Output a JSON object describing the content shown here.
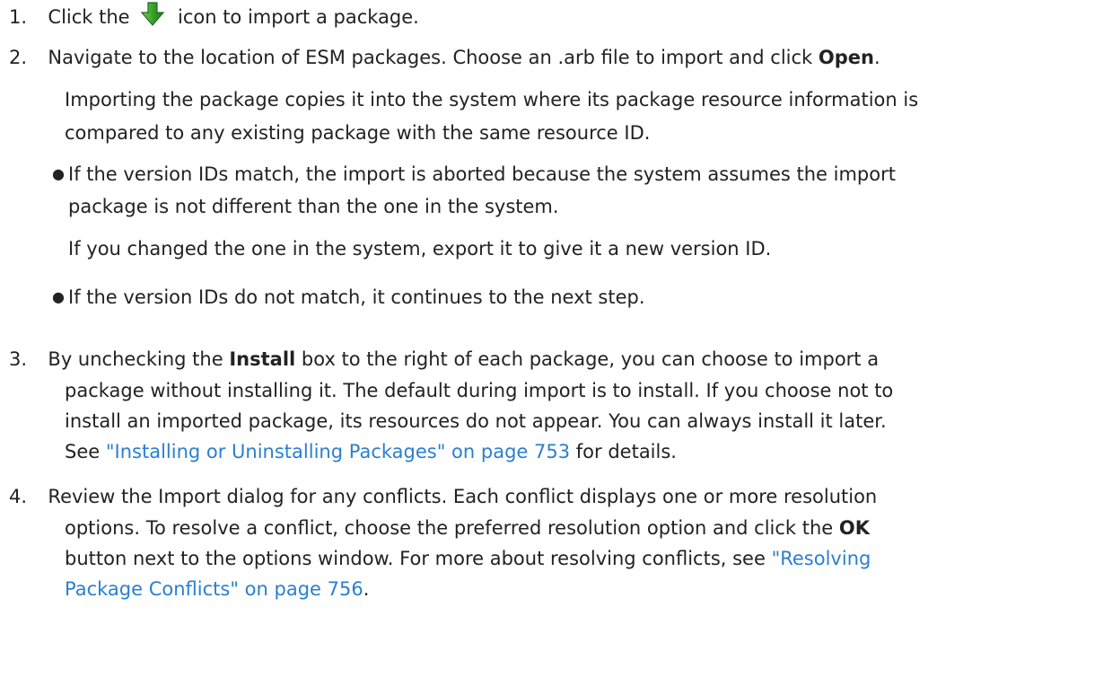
{
  "steps": [
    {
      "number": "1.",
      "before_icon": "Click the",
      "icon": "green-down-arrow-icon",
      "after_icon": "icon to import a package."
    },
    {
      "number": "2.",
      "line1_text": "Navigate to the location of ESM packages. Choose an .arb file to import and click",
      "line1_bold": "Open",
      "line1_end": ".",
      "para_line1": "Importing the package copies it into the system where its package resource information is",
      "para_line2": "compared to any existing package with the same resource ID.",
      "bullets": [
        {
          "line1": "If the version IDs match, the import is aborted because the system assumes the import",
          "line2": "package is not different than the one in the system.",
          "note": "If you changed the one in the system, export it to give it a new version ID."
        },
        {
          "line1": "If the version IDs do not match, it continues to the next step."
        }
      ]
    },
    {
      "number": "3.",
      "l1_pre": "By unchecking the",
      "l1_bold": "Install",
      "l1_post": "box to the right of each package, you can choose to import a",
      "l2": "package without installing it. The default during import is to install. If you choose not to",
      "l3": "install an imported package, its resources do not appear. You can always install it later.",
      "l4_pre": "See",
      "l4_link": "\"Installing or Uninstalling Packages\" on page 753",
      "l4_post": "for details."
    },
    {
      "number": "4.",
      "l1": "Review the Import dialog for any conflicts. Each conflict displays one or more resolution",
      "l2_pre": "options. To resolve a conflict, choose the preferred resolution option and click the",
      "l2_bold": "OK",
      "l3_pre": "button next to the options window. For more about resolving conflicts, see",
      "l3_link": "\"Resolving",
      "l4_link": "Package Conflicts\" on page 756",
      "l4_post": "."
    }
  ],
  "colors": {
    "text": "#222222",
    "link": "#2a7fd0",
    "icon": "#3aa12c"
  }
}
